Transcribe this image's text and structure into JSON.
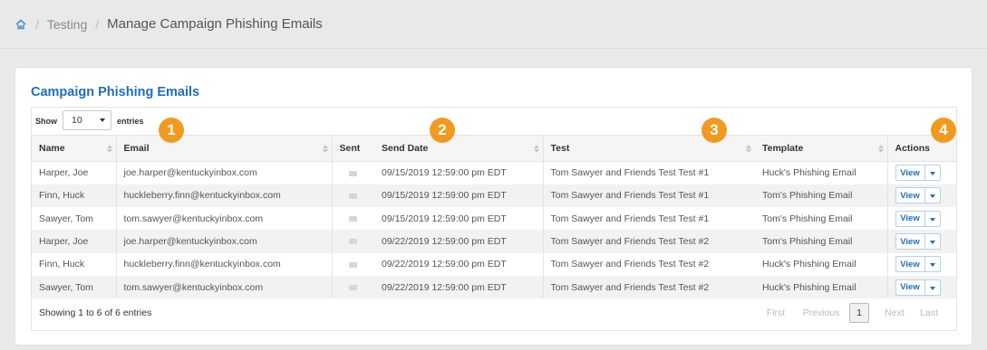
{
  "breadcrumb": {
    "items": [
      "Testing",
      "Manage Campaign Phishing Emails"
    ]
  },
  "panel": {
    "title": "Campaign Phishing Emails"
  },
  "length": {
    "show_label": "Show",
    "value": "10",
    "entries_label": "entries"
  },
  "table": {
    "columns": [
      "Name",
      "Email",
      "Sent",
      "Send Date",
      "Test",
      "Template",
      "Actions"
    ],
    "rows": [
      {
        "name": "Harper, Joe",
        "email": "joe.harper@kentuckyinbox.com",
        "send_date": "09/15/2019 12:59:00 pm EDT",
        "test": "Tom Sawyer and Friends Test Test #1",
        "template": "Huck's Phishing Email"
      },
      {
        "name": "Finn, Huck",
        "email": "huckleberry.finn@kentuckyinbox.com",
        "send_date": "09/15/2019 12:59:00 pm EDT",
        "test": "Tom Sawyer and Friends Test Test #1",
        "template": "Tom's Phishing Email"
      },
      {
        "name": "Sawyer, Tom",
        "email": "tom.sawyer@kentuckyinbox.com",
        "send_date": "09/15/2019 12:59:00 pm EDT",
        "test": "Tom Sawyer and Friends Test Test #1",
        "template": "Tom's Phishing Email"
      },
      {
        "name": "Harper, Joe",
        "email": "joe.harper@kentuckyinbox.com",
        "send_date": "09/22/2019 12:59:00 pm EDT",
        "test": "Tom Sawyer and Friends Test Test #2",
        "template": "Tom's Phishing Email"
      },
      {
        "name": "Finn, Huck",
        "email": "huckleberry.finn@kentuckyinbox.com",
        "send_date": "09/22/2019 12:59:00 pm EDT",
        "test": "Tom Sawyer and Friends Test Test #2",
        "template": "Huck's Phishing Email"
      },
      {
        "name": "Sawyer, Tom",
        "email": "tom.sawyer@kentuckyinbox.com",
        "send_date": "09/22/2019 12:59:00 pm EDT",
        "test": "Tom Sawyer and Friends Test Test #2",
        "template": "Huck's Phishing Email"
      }
    ],
    "view_label": "View"
  },
  "info": "Showing 1 to 6 of 6 entries",
  "pagination": {
    "first": "First",
    "previous": "Previous",
    "current": "1",
    "next": "Next",
    "last": "Last"
  },
  "markers": [
    "1",
    "2",
    "3",
    "4"
  ],
  "colors": {
    "accent": "#1f6fb8",
    "marker": "#f29a1f"
  }
}
